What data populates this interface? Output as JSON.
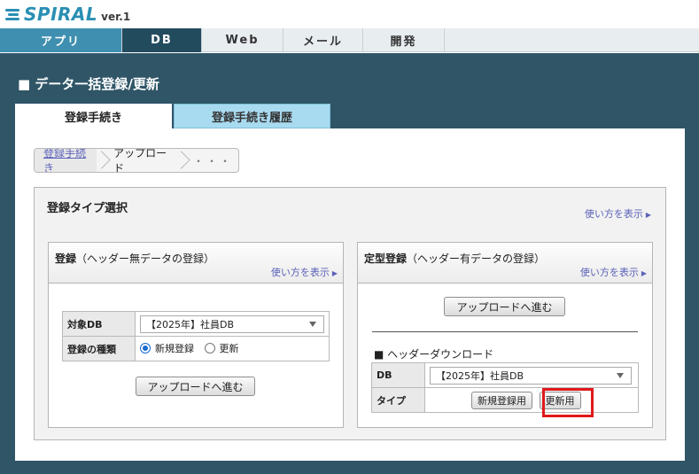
{
  "header": {
    "logo_text": "SPIRAL",
    "version": "ver.1"
  },
  "nav": {
    "tabs": [
      "アプリ",
      "DB",
      "Web",
      "メール",
      "開発"
    ],
    "active": "DB"
  },
  "page": {
    "title": "■ データ一括登録/更新"
  },
  "tabs": {
    "procedure": "登録手続き",
    "history": "登録手続き履歴",
    "active": "登録手続き"
  },
  "breadcrumb": {
    "step1": "登録手続き",
    "step2": "アップロード",
    "step3": "・・・"
  },
  "type_select": {
    "title": "登録タイプ選択",
    "help": "使い方を表示",
    "left": {
      "title_bold": "登録",
      "title_note": "（ヘッダー無データの登録）",
      "help": "使い方を表示",
      "target_db_label": "対象DB",
      "target_db_value": "【2025年】社員DB",
      "kind_label": "登録の種類",
      "kind_options": [
        "新規登録",
        "更新"
      ],
      "kind_selected": "新規登録",
      "upload_button": "アップロードへ進む"
    },
    "right": {
      "title_bold": "定型登録",
      "title_note": "（ヘッダー有データの登録）",
      "help": "使い方を表示",
      "upload_button": "アップロードへ進む",
      "header_download_title": "■ ヘッダーダウンロード",
      "db_label": "DB",
      "db_value": "【2025年】社員DB",
      "type_label": "タイプ",
      "new_button": "新規登録用",
      "update_button": "更新用"
    }
  },
  "colors": {
    "nav_app": "#3f8fb0",
    "nav_db": "#234b5e",
    "main_bg": "#2f5567",
    "tab_hist": "#a9dbf0",
    "highlight": "#e0191b",
    "link": "#5b61b8"
  }
}
